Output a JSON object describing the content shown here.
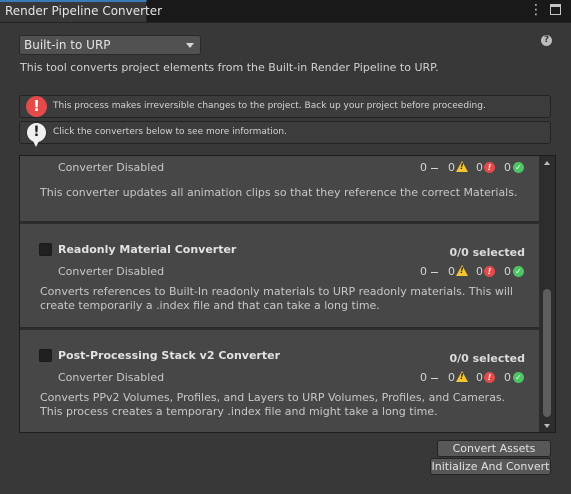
{
  "window": {
    "tab_title": "Render Pipeline Converter",
    "menu_glyph": "⋮"
  },
  "header": {
    "dropdown_value": "Built-in to URP",
    "help_glyph": "?",
    "description": "This tool converts project elements from the Built-in Render Pipeline to URP."
  },
  "notices": [
    {
      "type": "error",
      "glyph": "!",
      "text": "This process makes irreversible changes to the project. Back up your project before proceeding."
    },
    {
      "type": "info",
      "glyph": "!",
      "text": "Click the converters below to see more information."
    }
  ],
  "converters": [
    {
      "status": "Converter Disabled",
      "description": "This converter updates all animation clips so that they reference the correct Materials.",
      "counts": {
        "total": "0",
        "warnings": "0",
        "errors": "0",
        "success": "0"
      }
    },
    {
      "title": "Readonly Material Converter",
      "selected": "0/0 selected",
      "status": "Converter Disabled",
      "description": "Converts references to Built-In readonly materials to URP readonly materials. This will create temporarily a .index file and that can take a long time.",
      "counts": {
        "total": "0",
        "warnings": "0",
        "errors": "0",
        "success": "0"
      }
    },
    {
      "title": "Post-Processing Stack v2 Converter",
      "selected": "0/0 selected",
      "status": "Converter Disabled",
      "description": "Converts PPv2 Volumes, Profiles, and Layers to URP Volumes, Profiles, and Cameras. This process creates a temporary .index file and might take a long time.",
      "counts": {
        "total": "0",
        "warnings": "0",
        "errors": "0",
        "success": "0"
      }
    }
  ],
  "icons": {
    "warning": "warning-icon",
    "error": "error-icon",
    "success": "check-icon"
  },
  "buttons": {
    "convert_assets": "Convert Assets",
    "initialize_and_convert": "Initialize And Convert"
  },
  "colors": {
    "accent": "#3a79bb",
    "error": "#e34a4a",
    "warning": "#f4c430",
    "success": "#4cc563"
  }
}
